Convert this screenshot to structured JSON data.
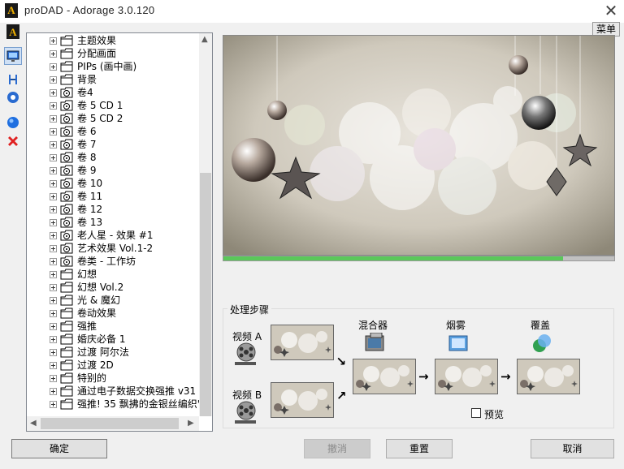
{
  "window": {
    "title": "proDAD - Adorage 3.0.120",
    "logo_letter": "A",
    "close_glyph": "✕",
    "menu_label": "菜单"
  },
  "sidebar_icons": [
    "adorage-logo-icon",
    "monitor-icon",
    "tools-icon",
    "settings-gear-icon",
    "blue-sphere-icon",
    "delete-x-icon"
  ],
  "tree": {
    "items": [
      {
        "label": "主题效果",
        "icon": "folder-icon"
      },
      {
        "label": "分配画面",
        "icon": "folder-icon"
      },
      {
        "label": "PIPs (画中画)",
        "icon": "folder-icon"
      },
      {
        "label": "背景",
        "icon": "folder-icon"
      },
      {
        "label": "卷4",
        "icon": "disc-folder-icon"
      },
      {
        "label": "卷 5 CD 1",
        "icon": "disc-folder-icon"
      },
      {
        "label": "卷 5 CD 2",
        "icon": "disc-folder-icon"
      },
      {
        "label": "卷 6",
        "icon": "disc-folder-icon"
      },
      {
        "label": "卷 7",
        "icon": "disc-folder-icon"
      },
      {
        "label": "卷 8",
        "icon": "disc-folder-icon"
      },
      {
        "label": "卷 9",
        "icon": "disc-folder-icon"
      },
      {
        "label": "卷 10",
        "icon": "disc-folder-icon"
      },
      {
        "label": "卷 11",
        "icon": "disc-folder-icon"
      },
      {
        "label": "卷 12",
        "icon": "disc-folder-icon"
      },
      {
        "label": "卷 13",
        "icon": "disc-folder-icon"
      },
      {
        "label": "老人星 - 效果 #1",
        "icon": "disc-folder-icon"
      },
      {
        "label": "艺术效果 Vol.1-2",
        "icon": "disc-folder-icon"
      },
      {
        "label": "卷类 - 工作坊",
        "icon": "disc-folder-icon"
      },
      {
        "label": "幻想",
        "icon": "folder-icon"
      },
      {
        "label": "幻想 Vol.2",
        "icon": "folder-icon"
      },
      {
        "label": "光 & 魔幻",
        "icon": "folder-icon"
      },
      {
        "label": "卷动效果",
        "icon": "folder-icon"
      },
      {
        "label": "强推",
        "icon": "folder-icon"
      },
      {
        "label": "婚庆必备 1",
        "icon": "folder-icon"
      },
      {
        "label": "过渡 阿尔法",
        "icon": "folder-icon"
      },
      {
        "label": "过渡 2D",
        "icon": "folder-icon"
      },
      {
        "label": "特别的",
        "icon": "folder-icon"
      },
      {
        "label": "通过电子数据交换强推 v31 ā",
        "icon": "folder-icon"
      },
      {
        "label": "强推! 35 飘拂的金银丝编织'",
        "icon": "folder-icon"
      }
    ]
  },
  "preview": {
    "progress_fraction": 0.87
  },
  "process": {
    "title": "处理步骤",
    "video_a": "视频 A",
    "video_b": "视频 B",
    "mixer": "混合器",
    "smoke": "烟雾",
    "overlay": "覆盖",
    "preview_checkbox": "预览",
    "arrow_glyph": "→"
  },
  "buttons": {
    "ok": "确定",
    "undo": "撤消",
    "reset": "重置",
    "cancel": "取消"
  }
}
